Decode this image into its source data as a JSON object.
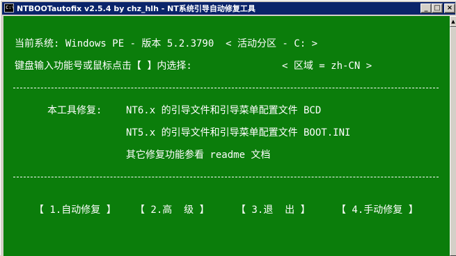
{
  "window": {
    "icon_text": "C:\\",
    "title": "NTBOOTautofix v2.5.4 by chz_hlh - NT系统引导自动修复工具",
    "min_symbol": "_",
    "max_symbol": "□",
    "close_symbol": "×"
  },
  "console": {
    "current_system": "当前系统: Windows PE - 版本 5.2.3790  < 活动分区 - C: >",
    "prompt": "键盘输入功能号或鼠标点击【 】内选择:",
    "locale": "< 区域 = zh-CN >",
    "rule": "-------------------------------------------------------------------------------------------",
    "tool_label": "本工具修复:",
    "fix_nt6": "NT6.x 的引导文件和引导菜单配置文件 BCD",
    "fix_nt5": "NT5.x 的引导文件和引导菜单配置文件 BOOT.INI",
    "other": "其它修复功能参看 readme 文档",
    "menu": [
      "【 1.自动修复 】",
      "【 2.高  级 】",
      "【 3.退  出 】",
      "【 4.手动修复 】"
    ]
  },
  "colors": {
    "console_bg": "#0b7d0b",
    "console_text": "#ffffff",
    "titlebar": "#0a246a"
  }
}
